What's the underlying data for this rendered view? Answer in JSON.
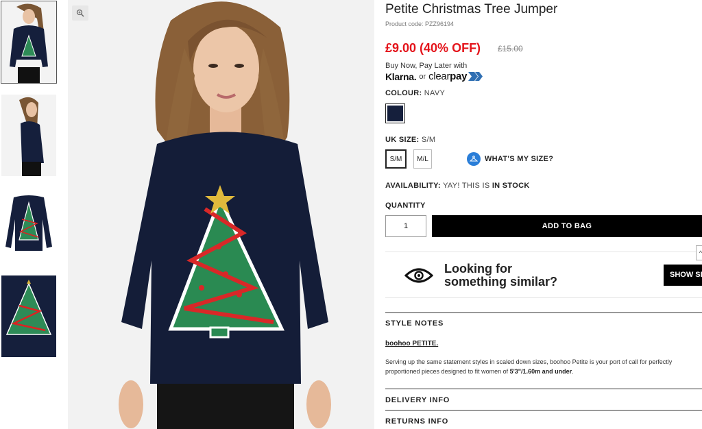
{
  "product": {
    "title": "Petite Christmas Tree Jumper",
    "code": "Product code: PZZ96194",
    "price": "£9.00 (40% OFF)",
    "was_price": "£15.00"
  },
  "payment": {
    "bnpl_text": "Buy Now, Pay Later with",
    "klarna": "Klarna.",
    "or": "or",
    "clearpay_a": "clear",
    "clearpay_b": "pay"
  },
  "colour": {
    "label": "COLOUR:",
    "value": "NAVY",
    "swatch_hex": "#151f3c"
  },
  "size": {
    "label": "UK SIZE:",
    "value": "S/M",
    "options": [
      "S/M",
      "M/L"
    ],
    "whats_my_size": "WHAT'S MY SIZE?"
  },
  "availability": {
    "label": "AVAILABILITY:",
    "text": "YAY! THIS IS",
    "status": "IN STOCK"
  },
  "quantity": {
    "label": "QUANTITY",
    "value": "1"
  },
  "add_to_bag": "ADD TO BAG",
  "similar": {
    "line1": "Looking for",
    "line2": "something similar?",
    "button": "SHOW SIMILAR"
  },
  "style_notes": {
    "title": "STYLE NOTES",
    "brand": "boohoo PETITE.",
    "desc_line1": "Serving up the same statement styles in scaled down sizes, boohoo Petite is your port of call for perfectly",
    "desc_line2_pre": "proportioned pieces designed to fit women of",
    "desc_line2_bold": "5'3\"/1.60m and under"
  },
  "delivery_info": "DELIVERY INFO",
  "returns_info": "RETURNS INFO",
  "colors": {
    "accent_red": "#e4141b",
    "navy": "#151f3c",
    "tree_green": "#2e8b57"
  }
}
